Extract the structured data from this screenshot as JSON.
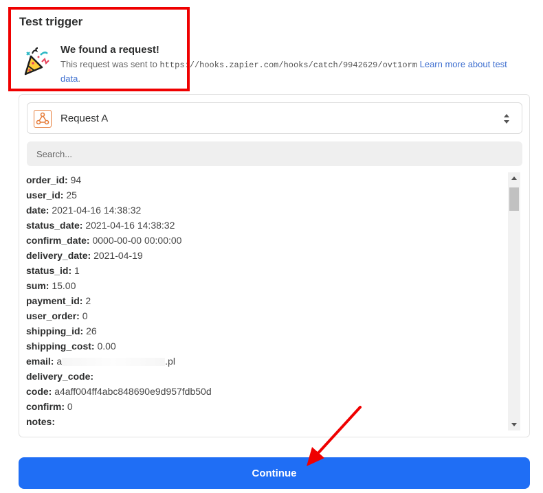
{
  "header": {
    "title": "Test trigger"
  },
  "found": {
    "title": "We found a request!",
    "prefix": "This request was sent to ",
    "url": "https://hooks.zapier.com/hooks/catch/9942629/ovt1orm",
    "link_text": "Learn more about test data",
    "suffix": "."
  },
  "selector": {
    "label": "Request A",
    "icon": "webhook-icon"
  },
  "search": {
    "placeholder": "Search...",
    "value": ""
  },
  "fields": [
    {
      "key": "order_id:",
      "value": "94"
    },
    {
      "key": "user_id:",
      "value": "25"
    },
    {
      "key": "date:",
      "value": "2021-04-16 14:38:32"
    },
    {
      "key": "status_date:",
      "value": "2021-04-16 14:38:32"
    },
    {
      "key": "confirm_date:",
      "value": "0000-00-00 00:00:00"
    },
    {
      "key": "delivery_date:",
      "value": "2021-04-19"
    },
    {
      "key": "status_id:",
      "value": "1"
    },
    {
      "key": "sum:",
      "value": "15.00"
    },
    {
      "key": "payment_id:",
      "value": "2"
    },
    {
      "key": "user_order:",
      "value": "0"
    },
    {
      "key": "shipping_id:",
      "value": "26"
    },
    {
      "key": "shipping_cost:",
      "value": "0.00"
    },
    {
      "key": "email:",
      "value": "a",
      "value_end": ".pl",
      "redacted": true
    },
    {
      "key": "delivery_code:",
      "value": ""
    },
    {
      "key": "code:",
      "value": "a4aff004ff4abc848690e9d957fdb50d"
    },
    {
      "key": "confirm:",
      "value": "0"
    },
    {
      "key": "notes:",
      "value": ""
    }
  ],
  "footer": {
    "continue_label": "Continue"
  },
  "colors": {
    "highlight": "#ef0000",
    "primary": "#1f6ef5",
    "link": "#3d6ecf",
    "arrow": "#ef0000"
  }
}
